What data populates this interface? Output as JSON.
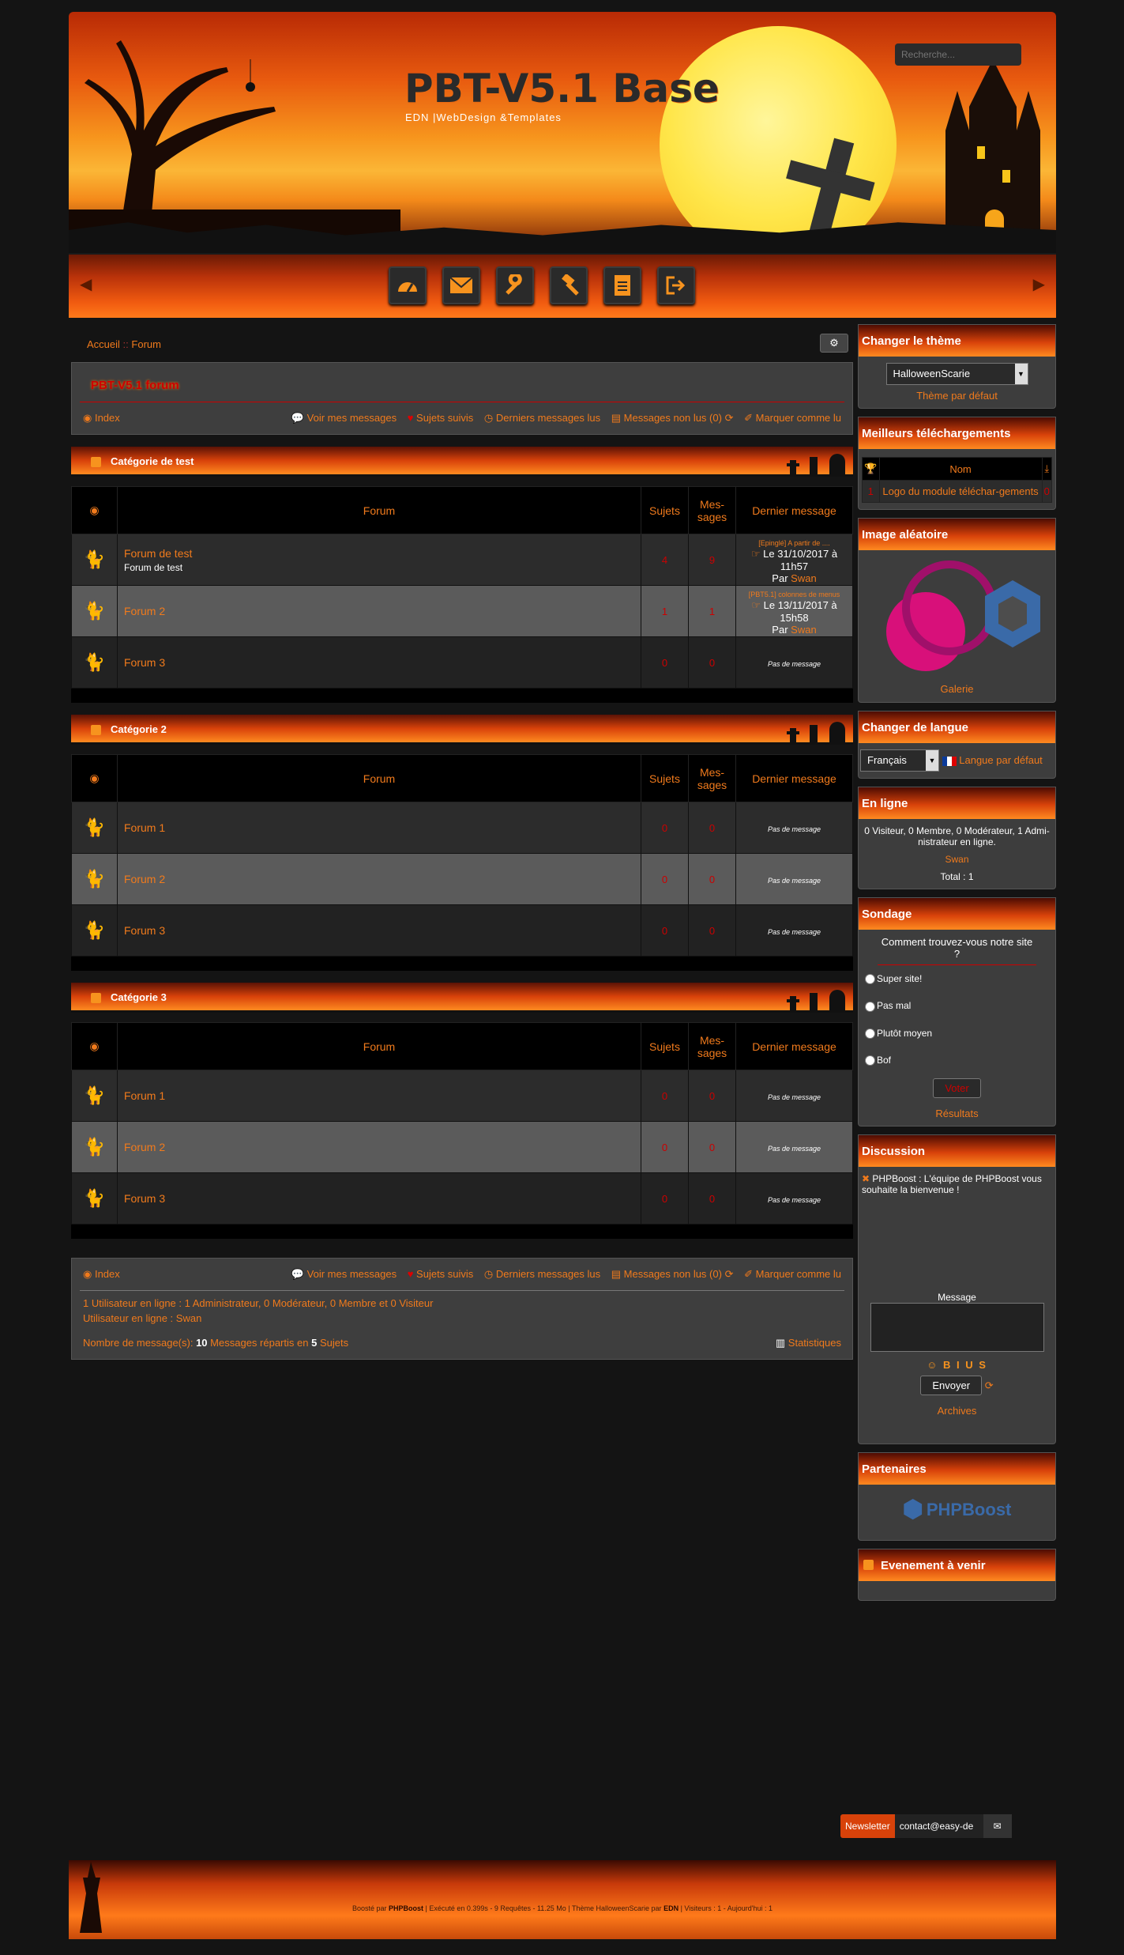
{
  "header": {
    "title": "PBT-V5.1 Base",
    "subtitle": "EDN |WebDesign &Templates",
    "search_placeholder": "Recherche..."
  },
  "menu": {
    "items": [
      "gauge-icon",
      "envelope-icon",
      "wrench-icon",
      "gavel-icon",
      "document-icon",
      "logout-icon"
    ]
  },
  "breadcrumb": {
    "home": "Accueil",
    "sep": "::",
    "current": "Forum"
  },
  "forum": {
    "title": "PBT-V5.1 forum",
    "nav": {
      "index": "Index",
      "my_messages": "Voir mes messages",
      "followed": "Sujets suivis",
      "last_read": "Derniers messages lus",
      "unread": "Messages non lus (0)",
      "mark_read": "Marquer comme lu"
    },
    "columns": {
      "forum": "Forum",
      "topics": "Sujets",
      "messages": "Mes-sages",
      "last": "Dernier message"
    },
    "categories": [
      {
        "name": "Catégorie de test",
        "rows": [
          {
            "name": "Forum de test",
            "desc": "Forum de test",
            "topics": "4",
            "messages": "9",
            "last_title": "[Epinglé] A partir de ....",
            "last_date": "Le 31/10/2017 à 11h57",
            "last_by": "Par",
            "last_user": "Swan"
          },
          {
            "name": "Forum 2",
            "desc": "",
            "topics": "1",
            "messages": "1",
            "last_title": "[PBT5.1] colonnes de menus",
            "last_date": "Le 13/11/2017 à 15h58",
            "last_by": "Par",
            "last_user": "Swan"
          },
          {
            "name": "Forum 3",
            "desc": "",
            "topics": "0",
            "messages": "0",
            "last_none": "Pas de message"
          }
        ]
      },
      {
        "name": "Catégorie 2",
        "rows": [
          {
            "name": "Forum 1",
            "topics": "0",
            "messages": "0",
            "last_none": "Pas de message"
          },
          {
            "name": "Forum 2",
            "topics": "0",
            "messages": "0",
            "last_none": "Pas de message"
          },
          {
            "name": "Forum 3",
            "topics": "0",
            "messages": "0",
            "last_none": "Pas de message"
          }
        ]
      },
      {
        "name": "Catégorie 3",
        "rows": [
          {
            "name": "Forum 1",
            "topics": "0",
            "messages": "0",
            "last_none": "Pas de message"
          },
          {
            "name": "Forum 2",
            "topics": "0",
            "messages": "0",
            "last_none": "Pas de message"
          },
          {
            "name": "Forum 3",
            "topics": "0",
            "messages": "0",
            "last_none": "Pas de message"
          }
        ]
      }
    ],
    "online_line": "1 Utilisateur en ligne : 1 Administrateur, 0 Modérateur, 0 Membre et 0 Visiteur",
    "online_users_label": "Utilisateur en ligne :",
    "online_users": "Swan",
    "messages_stat_prefix": "Nombre de message(s):",
    "messages_count": "10",
    "messages_stat_mid": "Messages répartis en",
    "topics_count": "5",
    "messages_stat_suffix": "Sujets",
    "statistics": "Statistiques"
  },
  "sidebar": {
    "theme": {
      "title": "Changer le thème",
      "selected": "HalloweenScarie",
      "default_link": "Thème par défaut"
    },
    "downloads": {
      "title": "Meilleurs téléchargements",
      "col_name": "Nom",
      "rank": "1",
      "name": "Logo du module téléchar-gements",
      "count": "0"
    },
    "image": {
      "title": "Image aléatoire",
      "gallery": "Galerie"
    },
    "lang": {
      "title": "Changer de langue",
      "selected": "Français",
      "default_link": "Langue par défaut"
    },
    "online": {
      "title": "En ligne",
      "text": "0 Visiteur, 0 Membre, 0 Modérateur, 1 Admi-nistrateur en ligne.",
      "user": "Swan",
      "total": "Total : 1"
    },
    "poll": {
      "title": "Sondage",
      "question": "Comment trouvez-vous notre site ?",
      "options": [
        "Super site!",
        "Pas mal",
        "Plutôt moyen",
        "Bof"
      ],
      "vote": "Voter",
      "results": "Résultats"
    },
    "chat": {
      "title": "Discussion",
      "author": "PHPBoost :",
      "message": "L'équipe de PHPBoost vous souhaite la bienvenue !",
      "label": "Message",
      "format": "☺ B I U S",
      "send": "Envoyer",
      "archives": "Archives"
    },
    "partners": {
      "title": "Partenaires",
      "logo": "PHPBoost"
    },
    "events": {
      "title": "Evenement à venir"
    }
  },
  "newsletter": {
    "label": "Newsletter",
    "email": "contact@easy-de"
  },
  "footer": {
    "p1": "Boosté par",
    "phpboost": "PHPBoost",
    "p2": "| Exécuté en 0.399s - 9 Requêtes - 11.25 Mo | Thème HalloweenScarie par",
    "edn": "EDN",
    "p3": "| Visiteurs : 1 - Aujourd'hui : 1"
  }
}
